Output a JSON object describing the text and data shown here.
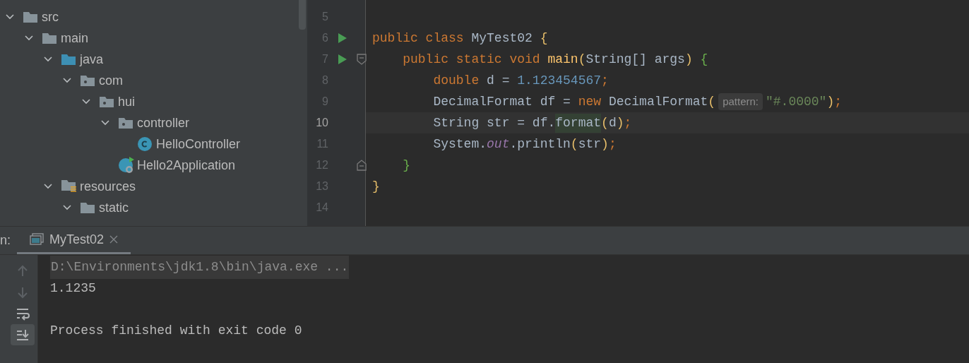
{
  "project_tree": [
    {
      "label": "src",
      "kind": "folder",
      "expanded": true,
      "children": [
        {
          "label": "main",
          "kind": "folder",
          "expanded": true,
          "children": [
            {
              "label": "java",
              "kind": "source",
              "expanded": true,
              "children": [
                {
                  "label": "com",
                  "kind": "package",
                  "expanded": true,
                  "children": [
                    {
                      "label": "hui",
                      "kind": "package",
                      "expanded": true,
                      "children": [
                        {
                          "label": "controller",
                          "kind": "package",
                          "expanded": true,
                          "children": [
                            {
                              "label": "HelloController",
                              "kind": "class"
                            }
                          ]
                        },
                        {
                          "label": "Hello2Application",
                          "kind": "application"
                        }
                      ]
                    }
                  ]
                }
              ]
            },
            {
              "label": "resources",
              "kind": "resources",
              "expanded": true,
              "children": [
                {
                  "label": "static",
                  "kind": "folder",
                  "expanded": true
                }
              ]
            }
          ]
        }
      ]
    }
  ],
  "editor": {
    "lines": [
      {
        "number": "5",
        "current": false,
        "run": false,
        "fold_start": false,
        "fold_end": false
      },
      {
        "number": "6",
        "current": false,
        "run": true,
        "fold_start": false,
        "fold_end": false,
        "tokens": [
          {
            "text": "public class ",
            "kind": "keyword"
          },
          {
            "text": "MyTest02 ",
            "kind": "plain"
          },
          {
            "text": "{",
            "kind": "brace"
          }
        ]
      },
      {
        "number": "7",
        "current": false,
        "run": true,
        "fold_start": true,
        "fold_end": false,
        "tokens": [
          {
            "text": "    public static void ",
            "kind": "keyword"
          },
          {
            "text": "main",
            "kind": "method"
          },
          {
            "text": "(",
            "kind": "brace"
          },
          {
            "text": "String[] args",
            "kind": "plain"
          },
          {
            "text": ")",
            "kind": "brace"
          },
          {
            "text": " {",
            "kind": "block-brace"
          }
        ]
      },
      {
        "number": "8",
        "current": false,
        "run": false,
        "fold_start": false,
        "fold_end": false,
        "tokens": [
          {
            "text": "        double ",
            "kind": "keyword"
          },
          {
            "text": "d = ",
            "kind": "plain"
          },
          {
            "text": "1.123454567",
            "kind": "number"
          },
          {
            "text": ";",
            "kind": "keyword"
          }
        ]
      },
      {
        "number": "9",
        "current": false,
        "run": false,
        "fold_start": false,
        "fold_end": false,
        "tokens": [
          {
            "text": "        DecimalFormat df = ",
            "kind": "plain"
          },
          {
            "text": "new ",
            "kind": "keyword"
          },
          {
            "text": "DecimalFormat",
            "kind": "plain"
          },
          {
            "text": "(",
            "kind": "brace"
          },
          {
            "text": "pattern:",
            "kind": "hint"
          },
          {
            "text": "\"#.0000\"",
            "kind": "string"
          },
          {
            "text": ")",
            "kind": "brace"
          },
          {
            "text": ";",
            "kind": "keyword"
          }
        ]
      },
      {
        "number": "10",
        "current": true,
        "run": false,
        "fold_start": false,
        "fold_end": false,
        "tokens": [
          {
            "text": "        String str = df.",
            "kind": "plain"
          },
          {
            "text": "format",
            "kind": "match"
          },
          {
            "text": "(",
            "kind": "brace"
          },
          {
            "text": "d",
            "kind": "plain"
          },
          {
            "text": ")",
            "kind": "brace"
          },
          {
            "text": ";",
            "kind": "keyword"
          }
        ]
      },
      {
        "number": "11",
        "current": false,
        "run": false,
        "fold_start": false,
        "fold_end": false,
        "tokens": [
          {
            "text": "        System.",
            "kind": "plain"
          },
          {
            "text": "out",
            "kind": "static-field"
          },
          {
            "text": ".println",
            "kind": "plain"
          },
          {
            "text": "(",
            "kind": "brace"
          },
          {
            "text": "str",
            "kind": "plain"
          },
          {
            "text": ")",
            "kind": "brace"
          },
          {
            "text": ";",
            "kind": "keyword"
          }
        ]
      },
      {
        "number": "12",
        "current": false,
        "run": false,
        "fold_start": false,
        "fold_end": true,
        "tokens": [
          {
            "text": "    }",
            "kind": "block-brace"
          }
        ]
      },
      {
        "number": "13",
        "current": false,
        "run": false,
        "fold_start": false,
        "fold_end": false,
        "tokens": [
          {
            "text": "}",
            "kind": "brace"
          }
        ]
      },
      {
        "number": "14",
        "current": false,
        "run": false,
        "fold_start": false,
        "fold_end": false
      }
    ]
  },
  "run_panel": {
    "label": "n:",
    "tabs": [
      {
        "label": "MyTest02",
        "selected": true
      }
    ],
    "tools": [
      {
        "kind": "up",
        "disabled": true,
        "selected": false
      },
      {
        "kind": "down",
        "disabled": true,
        "selected": false
      },
      {
        "kind": "wrap",
        "disabled": false,
        "selected": false
      },
      {
        "kind": "scroll-end",
        "disabled": false,
        "selected": true
      }
    ],
    "console": [
      {
        "text": "D:\\Environments\\jdk1.8\\bin\\java.exe ...",
        "kind": "command"
      },
      {
        "text": "1.1235",
        "kind": "output"
      },
      {
        "kind": "blank"
      },
      {
        "text": "Process finished with exit code 0",
        "kind": "output"
      }
    ]
  }
}
